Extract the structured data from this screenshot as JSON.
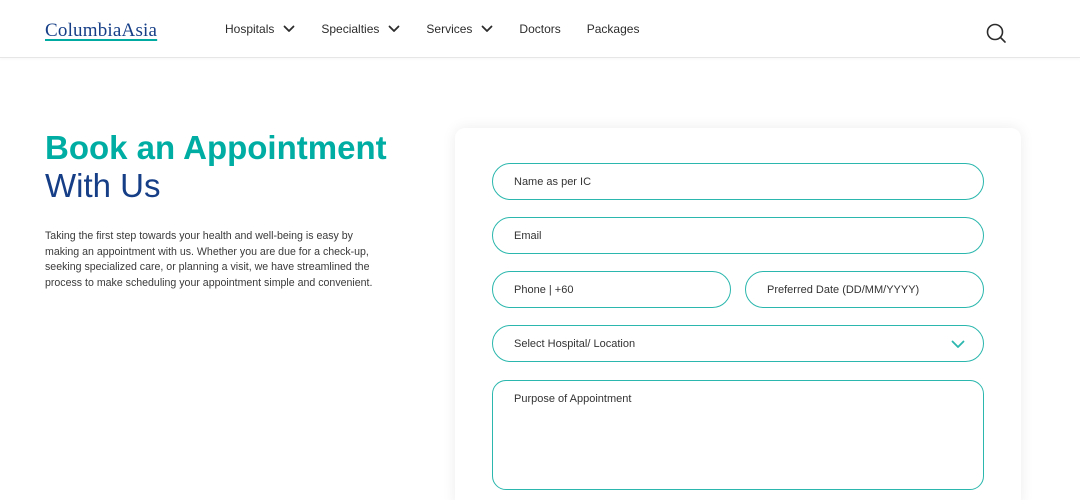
{
  "header": {
    "logo_text": "ColumbiaAsia",
    "nav": [
      {
        "label": "Hospitals",
        "has_dropdown": true
      },
      {
        "label": "Specialties",
        "has_dropdown": true
      },
      {
        "label": "Services",
        "has_dropdown": true
      },
      {
        "label": "Doctors",
        "has_dropdown": false
      },
      {
        "label": "Packages",
        "has_dropdown": false
      }
    ],
    "search_icon": "search-icon"
  },
  "main": {
    "title_line1": "Book an Appointment",
    "title_line2": "With Us",
    "description": "Taking the first step towards your health and well-being is easy by making an appointment with us. Whether you are due for a check-up, seeking specialized care, or planning a visit, we have streamlined the process to make scheduling your appointment simple and convenient."
  },
  "form": {
    "name_placeholder": "Name as per IC",
    "email_placeholder": "Email",
    "phone_placeholder": "Phone | +60",
    "date_placeholder": "Preferred Date (DD/MM/YYYY)",
    "hospital_select": "Select Hospital/ Location",
    "purpose_placeholder": "Purpose of Appointment"
  },
  "colors": {
    "teal": "#00ada3",
    "navy": "#153e87",
    "border": "#2bb7ad"
  }
}
